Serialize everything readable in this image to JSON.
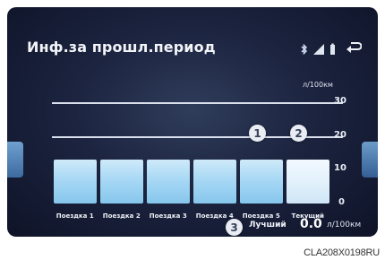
{
  "screen": {
    "title": "Инф.за прошл.период",
    "status_icons": [
      "bluetooth-icon",
      "signal-icon",
      "battery-icon"
    ],
    "back_icon": "back-arrow-icon"
  },
  "chart_data": {
    "type": "bar",
    "unit_label": "л/100км",
    "y_ticks": [
      "30",
      "20",
      "10",
      "0"
    ],
    "ylim": [
      0,
      30
    ],
    "categories": [
      "Поездка 1",
      "Поездка 2",
      "Поездка 3",
      "Поездка 4",
      "Поездка 5",
      "Текущий"
    ],
    "values": [
      13,
      13,
      13,
      13,
      13,
      13
    ],
    "grid": true
  },
  "callouts": [
    "1",
    "2",
    "3"
  ],
  "best": {
    "label": "Лучший",
    "value": "0.0",
    "unit": "л/100км"
  },
  "caption": "CLA208X0198RU",
  "colors": {
    "bar": "#9fd3f2",
    "bar_current": "#e6f3fc",
    "background": "#1c2440"
  }
}
